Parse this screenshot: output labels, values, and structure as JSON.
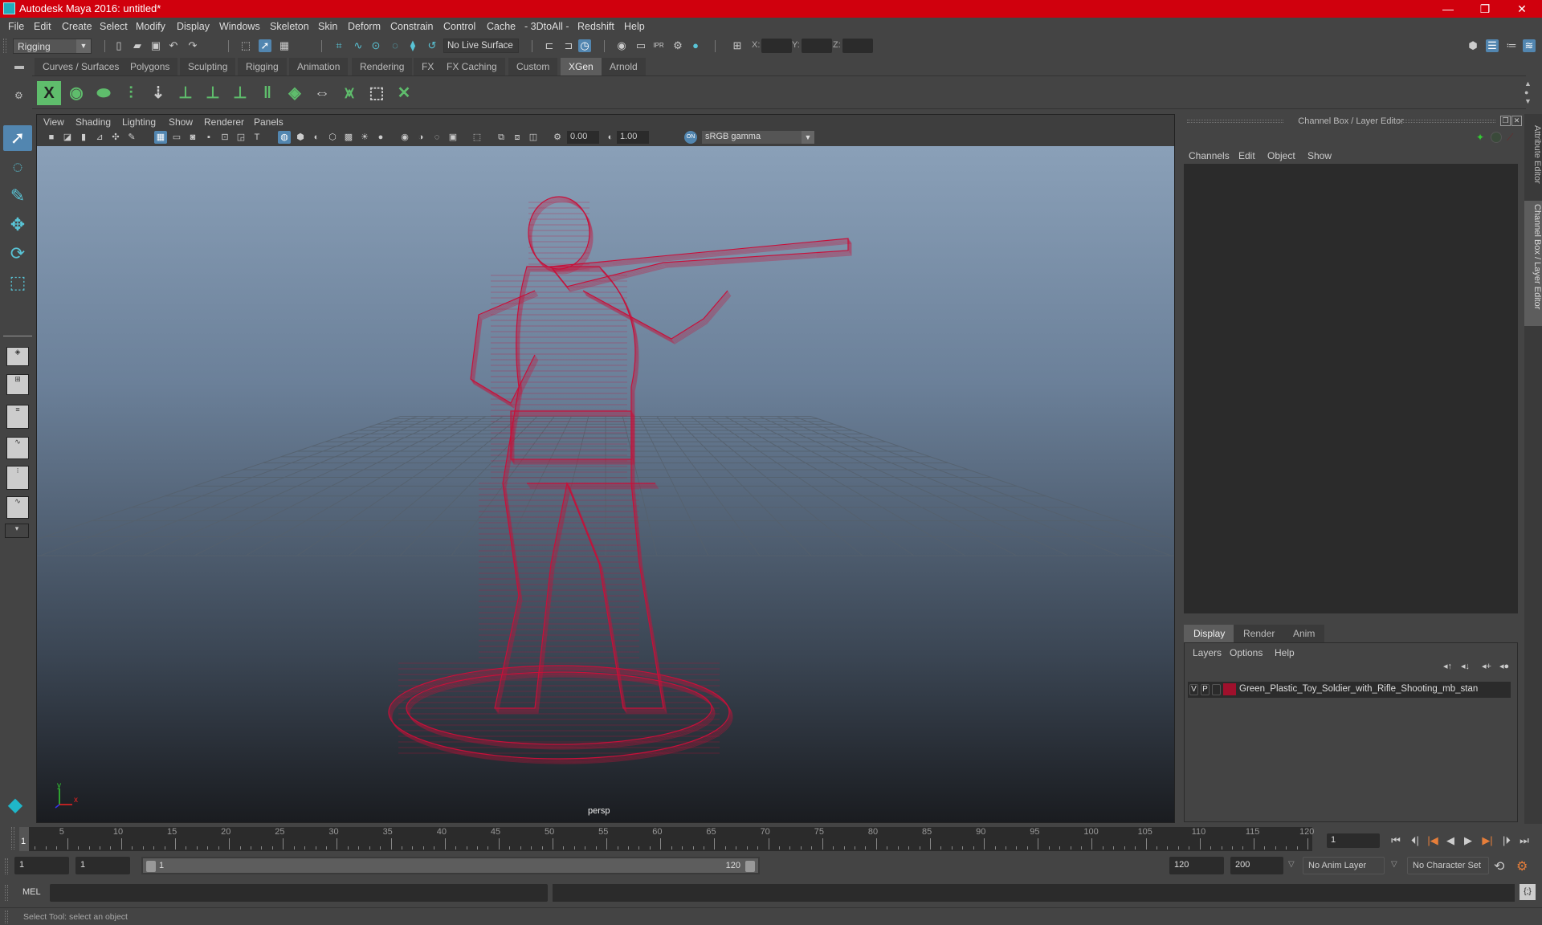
{
  "window": {
    "title": "Autodesk Maya 2016: untitled*",
    "controls": {
      "minimize": "—",
      "restore": "❐",
      "close": "✕"
    }
  },
  "menubar": [
    "File",
    "Edit",
    "Create",
    "Select",
    "Modify",
    "Display",
    "Windows",
    "Skeleton",
    "Skin",
    "Deform",
    "Constrain",
    "Control",
    "Cache",
    "- 3DtoAll -",
    "Redshift",
    "Help"
  ],
  "statusline": {
    "mode": "Rigging",
    "live_surface": "No Live Surface",
    "coords": {
      "x_label": "X:",
      "y_label": "Y:",
      "z_label": "Z:",
      "x": "",
      "y": "",
      "z": ""
    },
    "icons": [
      "new-scene-icon",
      "open-scene-icon",
      "save-scene-icon",
      "undo-icon",
      "redo-icon",
      "select-hierarchy-icon",
      "select-object-icon",
      "select-component-icon",
      "snap-grid-icon",
      "snap-curve-icon",
      "snap-point-icon",
      "snap-view-plane-icon",
      "snap-live-icon",
      "snap-projected-icon",
      "input-ops-icon",
      "output-ops-icon",
      "construction-history-icon",
      "render-view-icon",
      "render-frame-icon",
      "ipr-render-icon",
      "render-settings-icon",
      "hypershade-icon",
      "modeling-toolkit-icon",
      "human-ik-icon",
      "toggle-tool-settings-icon",
      "toggle-channel-box-icon"
    ]
  },
  "shelf": {
    "tabs": [
      "Curves / Surfaces",
      "Polygons",
      "Sculpting",
      "Rigging",
      "Animation",
      "Rendering",
      "FX",
      "FX Caching",
      "Custom",
      "XGen",
      "Arnold"
    ],
    "active_tab": "XGen",
    "icons": [
      "xgen-window-icon",
      "xgen-preview-icon",
      "xgen-clear-preview-icon",
      "xgen-add-guides-icon",
      "xgen-place-icon",
      "xgen-add-guide-icon",
      "xgen-show-guides-icon",
      "xgen-lock-guides-icon",
      "xgen-split-icon",
      "xgen-density-icon",
      "xgen-flip-icon",
      "xgen-select-region-icon",
      "xgen-region-icon",
      "xgen-delete-icon"
    ]
  },
  "toolbox": {
    "tools": [
      "select-tool",
      "lasso-tool",
      "paint-select-tool",
      "move-tool",
      "rotate-tool",
      "scale-tool"
    ],
    "active_tool": "select-tool"
  },
  "viewport": {
    "menu": [
      "View",
      "Shading",
      "Lighting",
      "Show",
      "Renderer",
      "Panels"
    ],
    "exposure": "0.00",
    "gamma": "1.00",
    "color_mgmt_label": "ON",
    "color_space": "sRGB gamma",
    "camera_label": "persp",
    "axis": {
      "x": "x",
      "y": "y"
    },
    "model_color": "#c8103a"
  },
  "channel_box": {
    "title": "Channel Box / Layer Editor",
    "menu": [
      "Channels",
      "Edit",
      "Object",
      "Show"
    ]
  },
  "layer_editor": {
    "tabs": [
      "Display",
      "Render",
      "Anim"
    ],
    "active_tab": "Display",
    "menu": [
      "Layers",
      "Options",
      "Help"
    ],
    "layers": [
      {
        "visible": "V",
        "playback": "P",
        "color": "#a0102c",
        "name": "Green_Plastic_Toy_Soldier_with_Rifle_Shooting_mb_stan"
      }
    ]
  },
  "side_tabs": [
    "Attribute Editor",
    "Channel Box / Layer Editor"
  ],
  "timeline": {
    "start": 1,
    "end": 120,
    "current": 1,
    "tick_labels": [
      "5",
      "10",
      "15",
      "20",
      "25",
      "30",
      "35",
      "40",
      "45",
      "50",
      "55",
      "60",
      "65",
      "70",
      "75",
      "80",
      "85",
      "90",
      "95",
      "100",
      "105",
      "110",
      "115",
      "120"
    ],
    "current_frame_field": "1",
    "playback_buttons": [
      "go-to-start",
      "step-back",
      "step-back-key",
      "play-backwards",
      "play-forwards",
      "step-forward-key",
      "step-forward",
      "go-to-end"
    ]
  },
  "range": {
    "start_field": "1",
    "playback_start_field": "1",
    "slider_start": "1",
    "slider_end": "120",
    "playback_end_field": "120",
    "end_field": "200",
    "anim_layer": "No Anim Layer",
    "character_set": "No Character Set"
  },
  "command_line": {
    "label": "MEL",
    "input": "",
    "output": ""
  },
  "help_line": "Select Tool: select an object"
}
